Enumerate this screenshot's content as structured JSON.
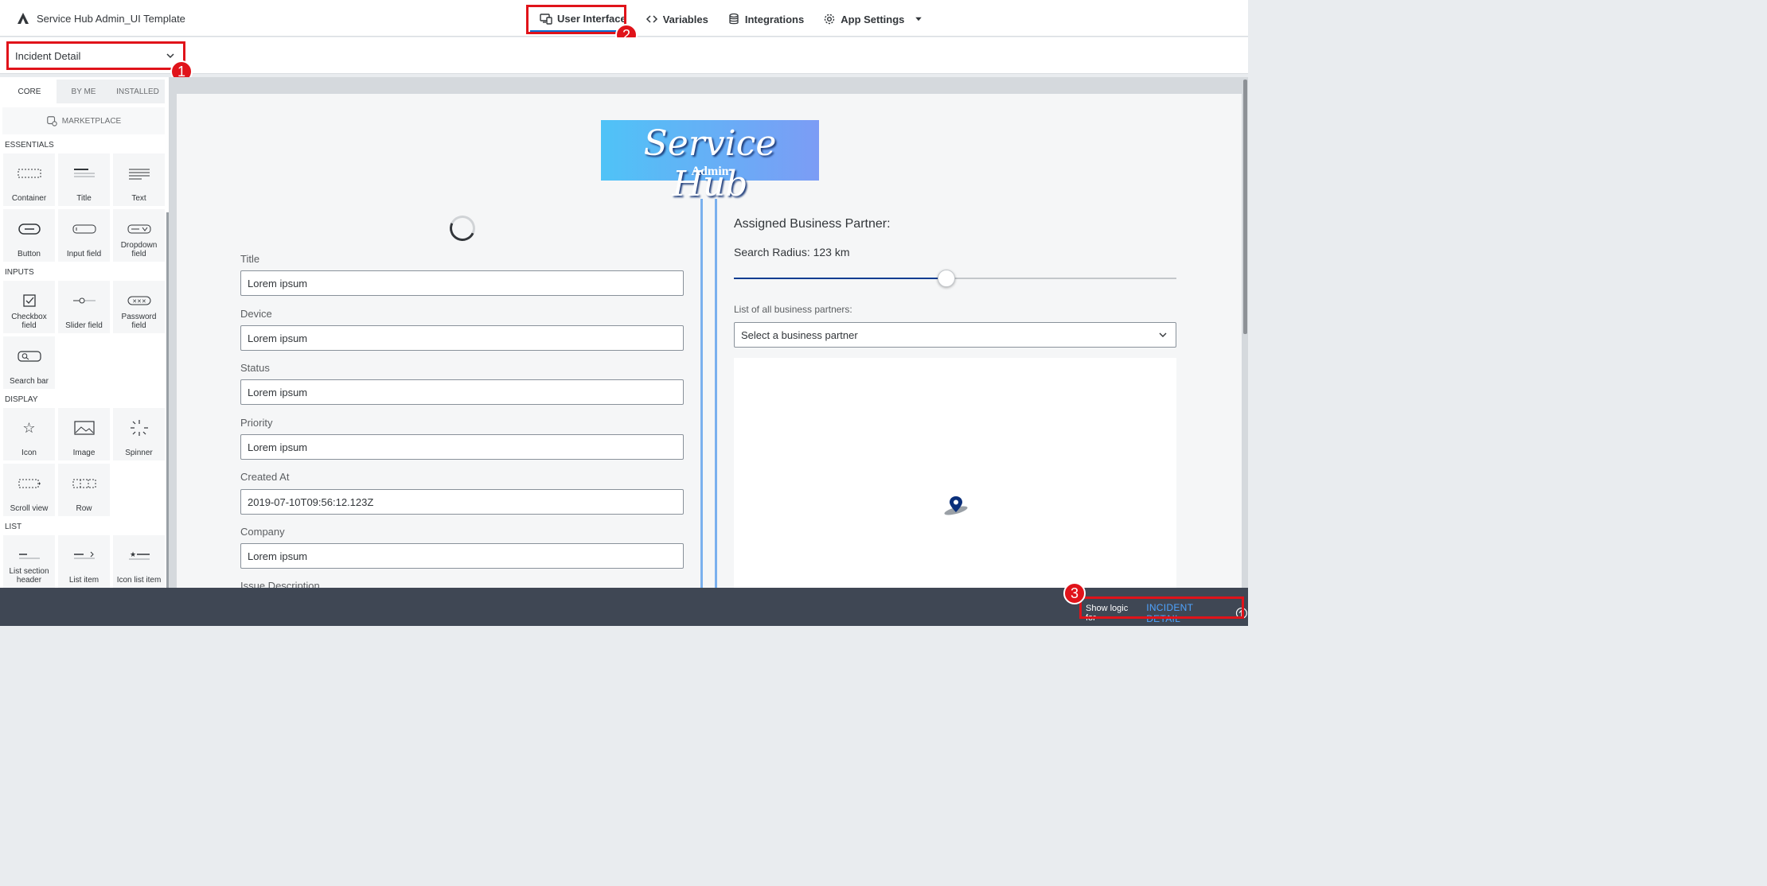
{
  "app": {
    "title": "Service Hub Admin_UI Template"
  },
  "nav": {
    "items": [
      {
        "label": "User Interface",
        "icon": "monitor-phone-icon"
      },
      {
        "label": "Variables",
        "icon": "code-brackets-icon"
      },
      {
        "label": "Integrations",
        "icon": "database-icon"
      },
      {
        "label": "App Settings",
        "icon": "gear-icon"
      }
    ]
  },
  "page_selector": {
    "value": "Incident Detail"
  },
  "annotations": {
    "b1": "1",
    "b2": "2",
    "b3": "3"
  },
  "palette": {
    "tabs": [
      "CORE",
      "BY ME",
      "INSTALLED"
    ],
    "marketplace": "MARKETPLACE",
    "sections": {
      "essentials": "ESSENTIALS",
      "inputs": "INPUTS",
      "display": "DISPLAY",
      "list": "LIST"
    },
    "tiles": {
      "container": "Container",
      "title": "Title",
      "text": "Text",
      "button": "Button",
      "input_field": "Input field",
      "dropdown_field": "Dropdown field",
      "checkbox_field": "Checkbox field",
      "slider_field": "Slider field",
      "password_field": "Password field",
      "search_bar": "Search bar",
      "icon": "Icon",
      "image": "Image",
      "spinner": "Spinner",
      "scroll_view": "Scroll view",
      "row": "Row",
      "list_section_header": "List section header",
      "list_item": "List item",
      "icon_list_item": "Icon list item"
    }
  },
  "canvas": {
    "logo": {
      "line1": "Service Hub",
      "line2": "Admin"
    },
    "fields": [
      {
        "label": "Title",
        "value": "Lorem ipsum"
      },
      {
        "label": "Device",
        "value": "Lorem ipsum"
      },
      {
        "label": "Status",
        "value": "Lorem ipsum"
      },
      {
        "label": "Priority",
        "value": "Lorem ipsum"
      },
      {
        "label": "Created At",
        "value": "2019-07-10T09:56:12.123Z"
      },
      {
        "label": "Company",
        "value": "Lorem ipsum"
      },
      {
        "label": "Issue Description",
        "value": ""
      }
    ],
    "right": {
      "title": "Assigned Business Partner:",
      "radius_text": "Search Radius: 123 km",
      "slider_fraction": 0.48,
      "list_label": "List of all business partners:",
      "select_placeholder": "Select a business partner"
    }
  },
  "bottom": {
    "show_logic_label": "Show logic for",
    "page_name": "INCIDENT DETAIL"
  },
  "colors": {
    "accent": "#0a6ed1",
    "highlight": "#e0131a",
    "bottom_bar": "#3f4754",
    "link": "#4fa4ff"
  }
}
